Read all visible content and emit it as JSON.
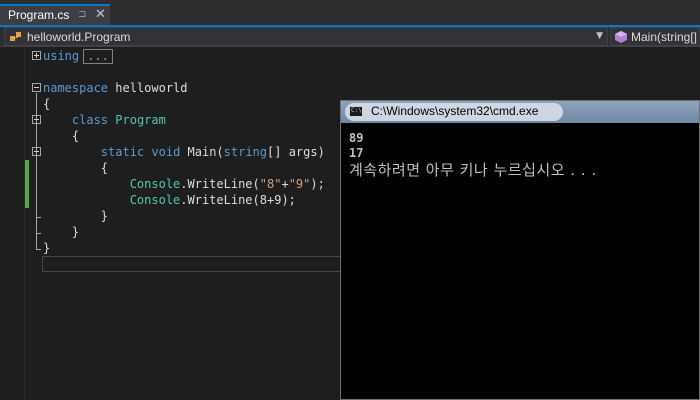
{
  "tab": {
    "title": "Program.cs",
    "pin_glyph": "⊐",
    "close_glyph": "✕"
  },
  "nav": {
    "left_scope": "helloworld.Program",
    "right_member": "Main(string[]"
  },
  "code": {
    "using_kw": "using",
    "using_ellipsis": "...",
    "ns_kw": "namespace",
    "ns_name": " helloworld",
    "brace_open": "{",
    "brace_close": "}",
    "class_kw": "class",
    "class_name": "Program",
    "static_kw": "static",
    "void_kw": "void",
    "main_sig_a": " Main(",
    "string_kw": "string",
    "main_sig_b": "[] args)",
    "console": "Console",
    "writeline": ".WriteLine(",
    "str8": "\"8\"",
    "plus": "+",
    "str9": "\"9\"",
    "close_paren": ");",
    "arg2": "8+9"
  },
  "cmd": {
    "title": "C:\\Windows\\system32\\cmd.exe",
    "icon_text": "C:\\",
    "lines": [
      "89",
      "17"
    ],
    "message": "계속하려면 아무 키나 누르십시오 . . ."
  }
}
